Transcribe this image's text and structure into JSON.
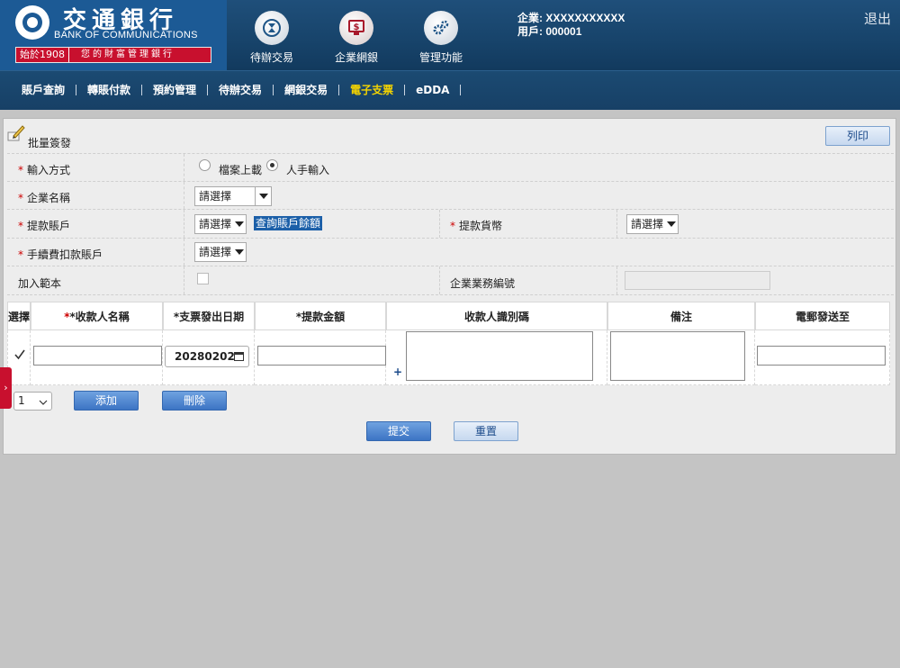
{
  "brand": {
    "name_cn": "交通銀行",
    "name_en": "BANK OF COMMUNICATIONS",
    "since": "始於1908",
    "slogan": "您的財富管理銀行"
  },
  "header_nav": [
    {
      "label": "待辦交易",
      "icon": "hourglass-icon"
    },
    {
      "label": "企業網銀",
      "icon": "monitor-dollar-icon"
    },
    {
      "label": "管理功能",
      "icon": "gears-icon"
    }
  ],
  "user": {
    "company": "企業: XXXXXXXXXXX",
    "account": "用戶: 000001"
  },
  "logout_label": "退出",
  "menu": [
    "賬戶查詢",
    "轉賬付款",
    "預約管理",
    "待辦交易",
    "網銀交易",
    "電子支票",
    "eDDA"
  ],
  "menu_active": "電子支票",
  "panel": {
    "title": "批量簽發",
    "print_label": "列印"
  },
  "form": {
    "input_method_label": "輸入方式",
    "input_method_options": [
      "檔案上載",
      "人手輸入"
    ],
    "input_method_selected": "人手輸入",
    "company_label": "企業名稱",
    "company_value": "請選擇",
    "debit_account_label": "提款賬戶",
    "debit_account_value": "請選擇",
    "balance_link": "查詢賬戶餘額",
    "currency_label": "提款貨幣",
    "currency_value": "請選擇",
    "fee_account_label": "手續費扣款賬戶",
    "fee_account_value": "請選擇",
    "template_label": "加入範本",
    "business_no_label": "企業業務編號"
  },
  "grid": {
    "headers": {
      "select": "選擇",
      "payee": "*收款人名稱",
      "date": "*支票發出日期",
      "amount": "*提款金額",
      "payee_id": "收款人識別碼",
      "remark": "備注",
      "email": "電郵發送至"
    },
    "row": {
      "date_value": "20280202",
      "plus": "+"
    }
  },
  "rows_select_value": "1",
  "buttons": {
    "add": "添加",
    "delete": "刪除",
    "submit": "提交",
    "reset": "重置"
  },
  "side_tab": "›"
}
